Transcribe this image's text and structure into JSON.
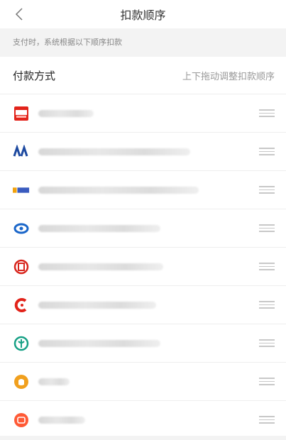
{
  "nav": {
    "title": "扣款顺序",
    "back_icon": "chevron-left-icon"
  },
  "hint": "支付时，系统根据以下顺序扣款",
  "section": {
    "title": "付款方式",
    "tip": "上下拖动调整扣款顺序"
  },
  "methods": [
    {
      "icon": "baitiao-icon",
      "accent": "#e2231a"
    },
    {
      "icon": "pufa-bank-icon",
      "accent": "#1e4aa0"
    },
    {
      "icon": "bank-logo-icon",
      "accent": "#f2a20c"
    },
    {
      "icon": "swirl-bank-icon",
      "accent": "#1a66c9"
    },
    {
      "icon": "icbc-icon",
      "accent": "#d8251d"
    },
    {
      "icon": "ccb-c-icon",
      "accent": "#e2231a"
    },
    {
      "icon": "abc-icon",
      "accent": "#16a085"
    },
    {
      "icon": "coin-pouch-icon",
      "accent": "#f1a01e"
    },
    {
      "icon": "wallet-icon",
      "accent": "#ff5a36"
    }
  ]
}
